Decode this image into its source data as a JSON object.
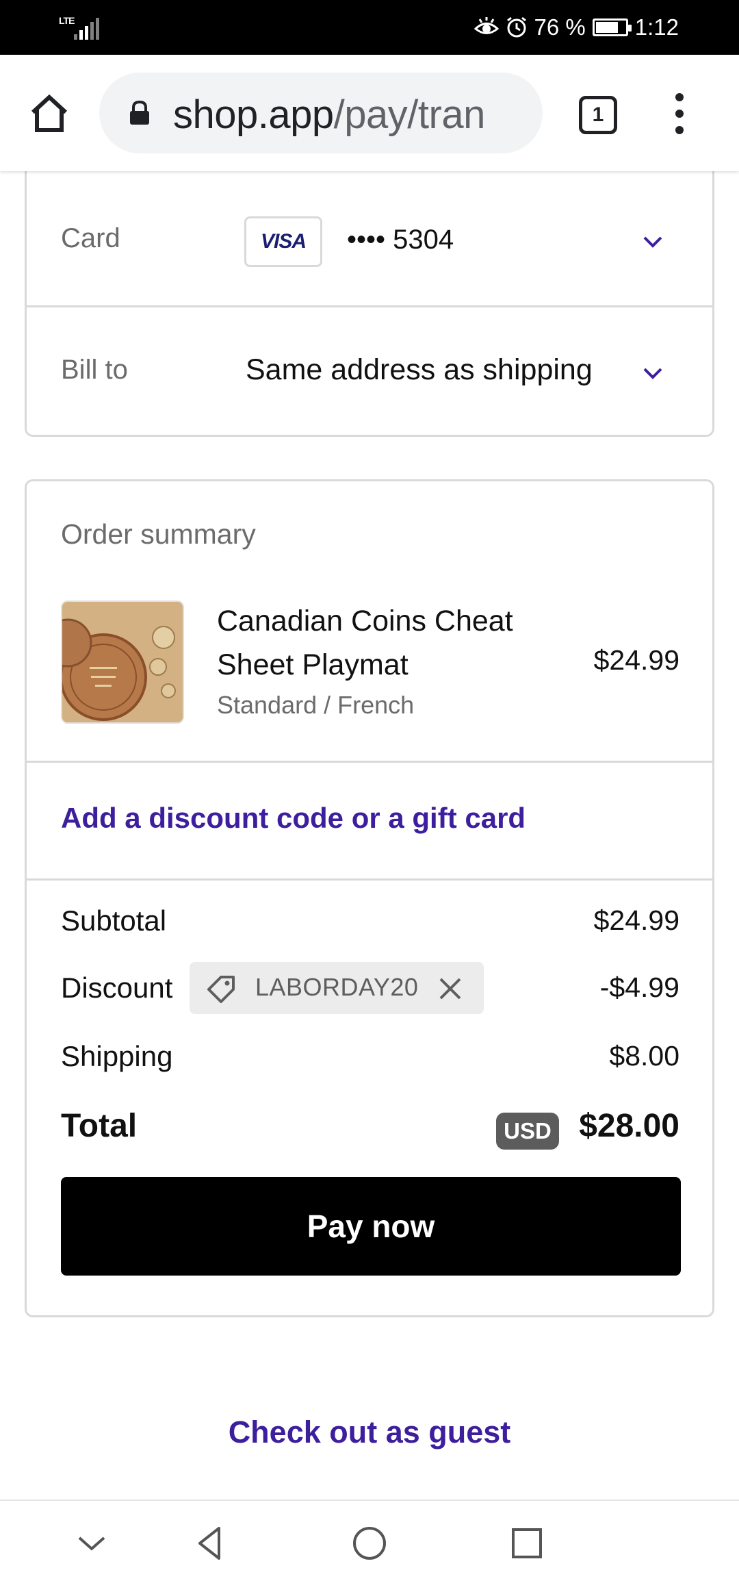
{
  "status_bar": {
    "network": "LTE",
    "battery_level": "76 %",
    "battery_fraction": 0.76,
    "time": "1:12",
    "icons": [
      "eye-comfort-icon",
      "alarm-icon",
      "battery-icon"
    ]
  },
  "browser": {
    "url_host": "shop.app",
    "url_path": "/pay/tran",
    "tab_count": "1",
    "icons": [
      "home-icon",
      "lock-icon",
      "tabs-icon",
      "menu-icon"
    ]
  },
  "payment": {
    "card_label": "Card",
    "card_brand": "VISA",
    "card_number": "•••• 5304",
    "bill_label": "Bill to",
    "bill_value": "Same address as shipping"
  },
  "summary": {
    "title": "Order summary",
    "product": {
      "name": "Canadian Coins Cheat Sheet Playmat",
      "variant": "Standard / French",
      "price": "$24.99"
    },
    "discount_link": "Add a discount code or a gift card",
    "subtotal_label": "Subtotal",
    "subtotal_value": "$24.99",
    "discount_label": "Discount",
    "discount_code": "LABORDAY20",
    "discount_value": "-$4.99",
    "shipping_label": "Shipping",
    "shipping_value": "$8.00",
    "total_label": "Total",
    "currency": "USD",
    "total_value": "$28.00",
    "pay_label": "Pay now"
  },
  "guest_link": "Check out as guest",
  "colors": {
    "link": "#3d1f9e",
    "pay_button": "#000000",
    "chevron": "#3d1f9e"
  }
}
